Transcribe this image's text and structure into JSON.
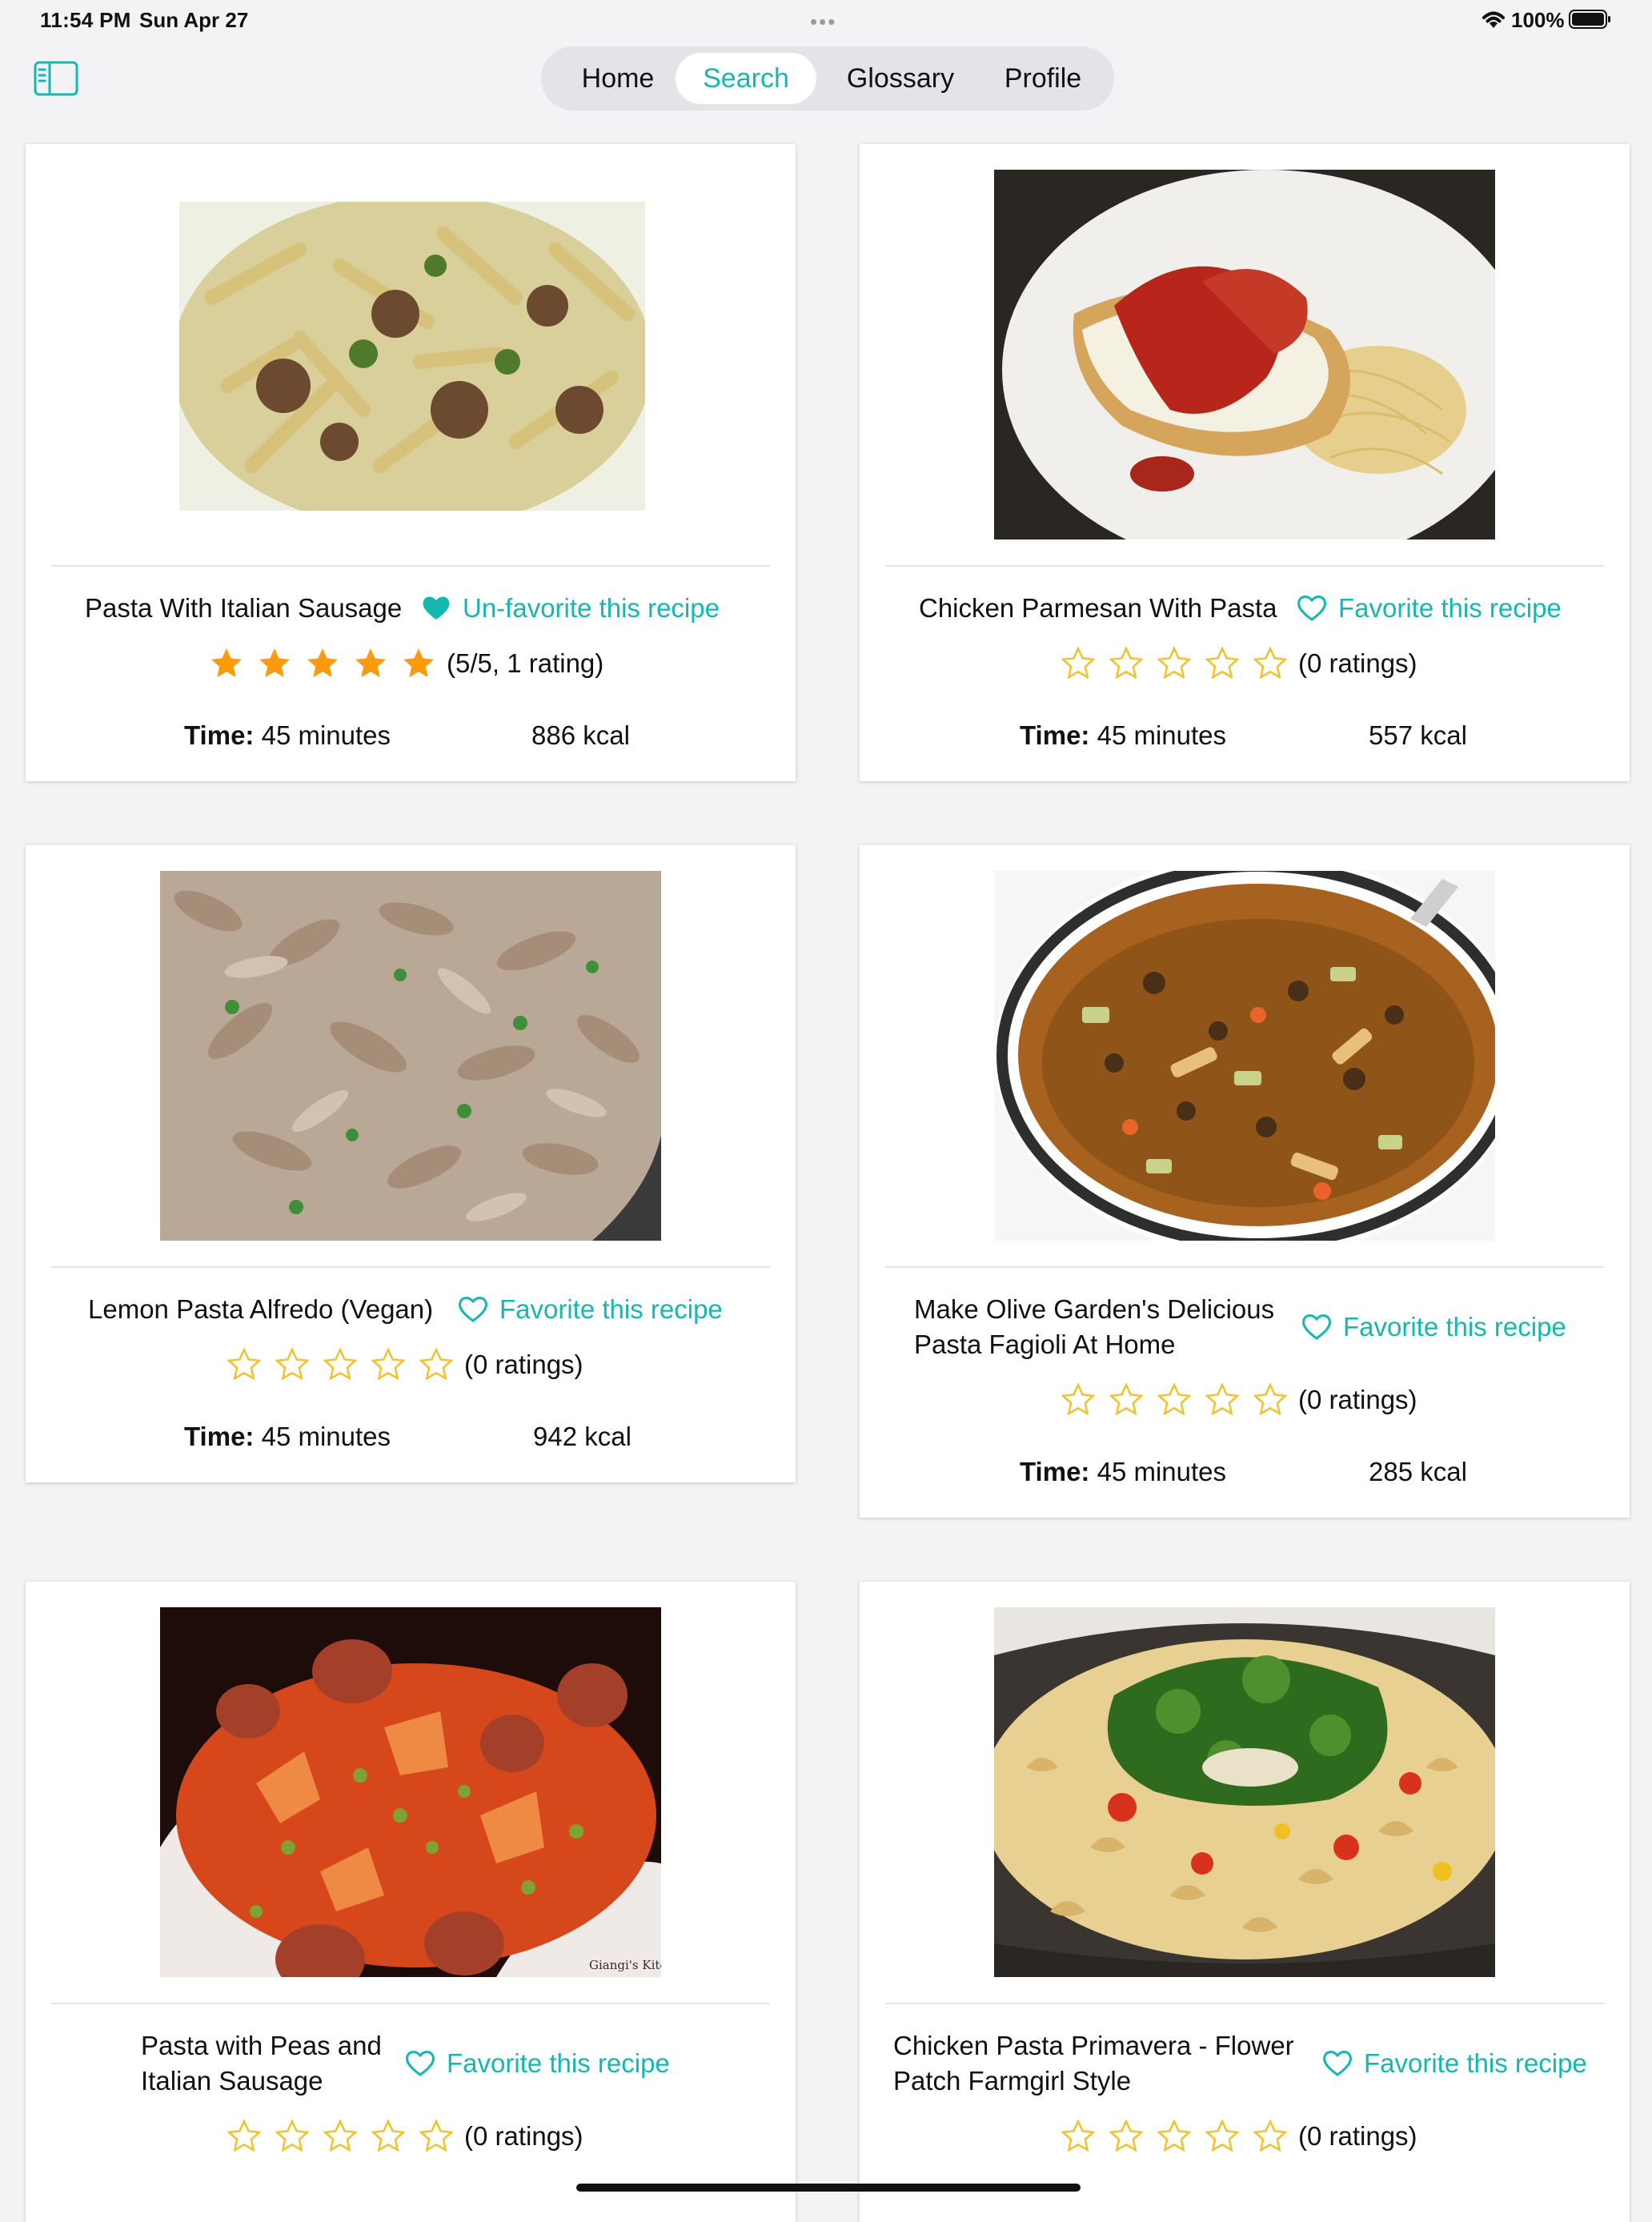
{
  "status_bar": {
    "time": "11:54 PM",
    "date": "Sun Apr 27",
    "dots": "•••",
    "battery": "100%"
  },
  "nav": {
    "tabs": [
      "Home",
      "Search",
      "Glossary",
      "Profile"
    ],
    "active_tab": "Search",
    "accent_color": "#14b8b0"
  },
  "recipes": [
    {
      "title": "Pasta With Italian Sausage",
      "favorited": true,
      "favorite_label": "Un-favorite this recipe",
      "stars_filled": 5,
      "rating_text": "(5/5, 1 rating)",
      "time_label": "Time:",
      "time_value": "45 minutes",
      "kcal": "886 kcal"
    },
    {
      "title": "Chicken Parmesan With Pasta",
      "favorited": false,
      "favorite_label": "Favorite this recipe",
      "stars_filled": 0,
      "rating_text": "(0 ratings)",
      "time_label": "Time:",
      "time_value": "45 minutes",
      "kcal": "557 kcal"
    },
    {
      "title": "Lemon Pasta Alfredo (Vegan)",
      "favorited": false,
      "favorite_label": "Favorite this recipe",
      "stars_filled": 0,
      "rating_text": "(0 ratings)",
      "time_label": "Time:",
      "time_value": "45 minutes",
      "kcal": "942 kcal"
    },
    {
      "title_line1": "Make Olive Garden's Delicious",
      "title_line2": "Pasta Fagioli At Home",
      "favorited": false,
      "favorite_label": "Favorite this recipe",
      "stars_filled": 0,
      "rating_text": "(0 ratings)",
      "time_label": "Time:",
      "time_value": "45 minutes",
      "kcal": "285 kcal"
    },
    {
      "title_line1": "Pasta with Peas and",
      "title_line2": "Italian Sausage",
      "favorited": false,
      "favorite_label": "Favorite this recipe",
      "stars_filled": 0,
      "rating_text": "(0 ratings)"
    },
    {
      "title_line1": "Chicken Pasta Primavera - Flower",
      "title_line2": "Patch Farmgirl Style",
      "favorited": false,
      "favorite_label": "Favorite this recipe",
      "stars_filled": 0,
      "rating_text": "(0 ratings)"
    }
  ],
  "photo_watermark": "Giangi's Kitchen"
}
